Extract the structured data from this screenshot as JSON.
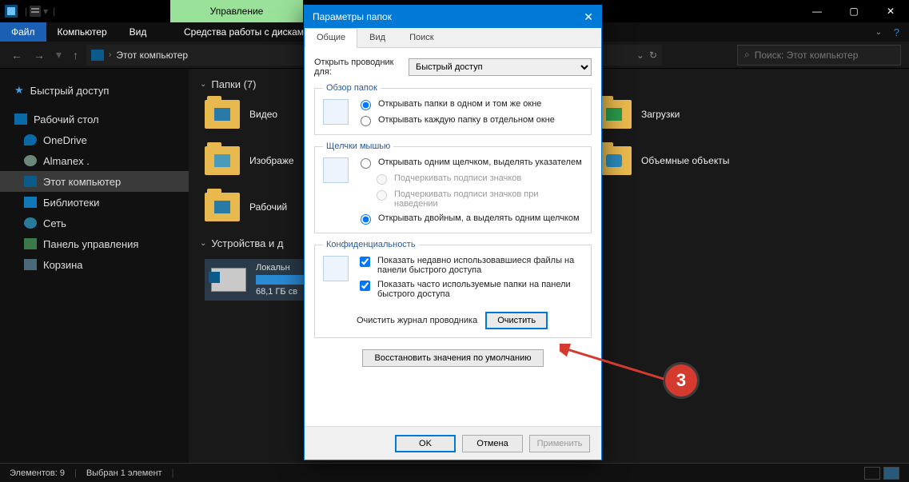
{
  "window": {
    "ribbon_context_tab": "Управление",
    "min": "—",
    "max": "▢",
    "close": "✕"
  },
  "menubar": {
    "file": "Файл",
    "computer": "Компьютер",
    "view": "Вид",
    "tools_label": "Средства работы с дисками",
    "help_glyph": "?"
  },
  "nav": {
    "back": "←",
    "fwd": "→",
    "up": "↑",
    "location": "Этот компьютер",
    "refresh": "↻",
    "search_placeholder": "Поиск: Этот компьютер",
    "search_glyph": "⌕"
  },
  "sidebar": {
    "quick_access": "Быстрый доступ",
    "desktop": "Рабочий стол",
    "onedrive": "OneDrive",
    "user": "Almanex .",
    "this_pc": "Этот компьютер",
    "libraries": "Библиотеки",
    "network": "Сеть",
    "control_panel": "Панель управления",
    "recycle_bin": "Корзина"
  },
  "content": {
    "group_folders": "Папки (7)",
    "folders": {
      "video": "Видео",
      "downloads": "Загрузки",
      "pictures": "Изображе",
      "objects3d": "Объемные объекты",
      "desktop": "Рабочий"
    },
    "group_devices": "Устройства и д",
    "drive": {
      "name": "Локальн",
      "free": "68,1 ГБ св"
    }
  },
  "status": {
    "items": "Элементов: 9",
    "selected": "Выбран 1 элемент"
  },
  "dialog": {
    "title": "Параметры папок",
    "tabs": {
      "general": "Общие",
      "view": "Вид",
      "search": "Поиск"
    },
    "open_explorer_label": "Открыть проводник для:",
    "open_explorer_value": "Быстрый доступ",
    "browse": {
      "legend": "Обзор папок",
      "same_window": "Открывать папки в одном и том же окне",
      "new_window": "Открывать каждую папку в отдельном окне"
    },
    "click": {
      "legend": "Щелчки мышью",
      "single": "Открывать одним щелчком, выделять указателем",
      "underline_always": "Подчеркивать подписи значков",
      "underline_hover": "Подчеркивать подписи значков при наведении",
      "double": "Открывать двойным, а выделять одним щелчком"
    },
    "privacy": {
      "legend": "Конфиденциальность",
      "recent_files": "Показать недавно использовавшиеся файлы на панели быстрого доступа",
      "freq_folders": "Показать часто используемые папки на панели быстрого доступа",
      "clear_label": "Очистить журнал проводника",
      "clear_btn": "Очистить"
    },
    "restore_defaults": "Восстановить значения по умолчанию",
    "ok": "OK",
    "cancel": "Отмена",
    "apply": "Применить"
  },
  "annotation": {
    "badge": "3"
  }
}
